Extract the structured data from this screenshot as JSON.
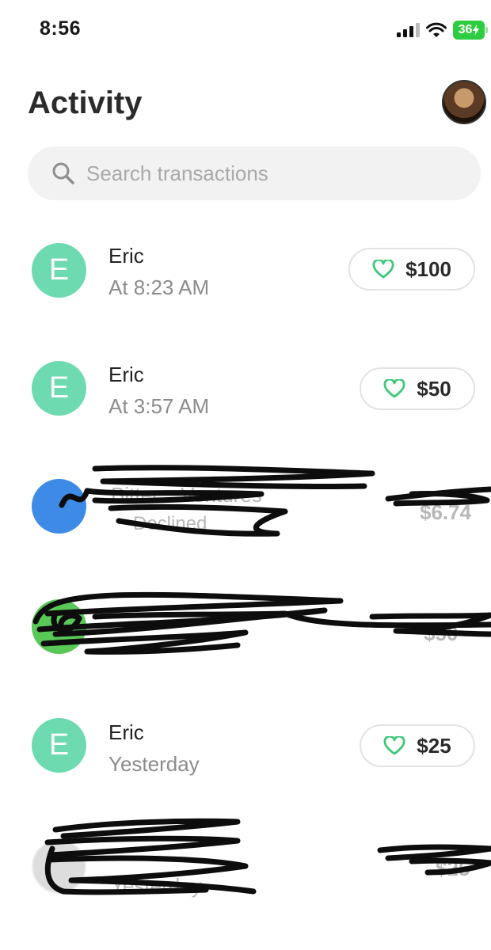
{
  "status_bar": {
    "time": "8:56",
    "battery": "36",
    "icons": [
      "signal-icon",
      "wifi-icon",
      "battery-icon"
    ]
  },
  "header": {
    "title": "Activity"
  },
  "search": {
    "placeholder": "Search transactions"
  },
  "transactions": [
    {
      "avatar_letter": "E",
      "name": "Eric",
      "time": "At 8:23 AM",
      "amount": "$100",
      "icon": "heart-icon"
    },
    {
      "avatar_letter": "E",
      "name": "Eric",
      "time": "At 3:57 AM",
      "amount": "$50",
      "icon": "heart-icon"
    },
    {
      "avatar_letter": "E",
      "name": "Eric",
      "time": "Yesterday",
      "amount": "$25",
      "icon": "heart-icon"
    }
  ],
  "redacted_rows": [
    {
      "name": "Bitter... Ventures",
      "status": "Declined",
      "amount": "$6.74"
    },
    {
      "name": "",
      "status": "",
      "amount": "$50"
    },
    {
      "name": "",
      "status": "Yesterday",
      "amount": "$25"
    }
  ],
  "colors": {
    "accent_green": "#6ddab0",
    "heart_green": "#3fc77a",
    "battery_green": "#2ecc40",
    "blue_avatar": "#3d8be6"
  }
}
